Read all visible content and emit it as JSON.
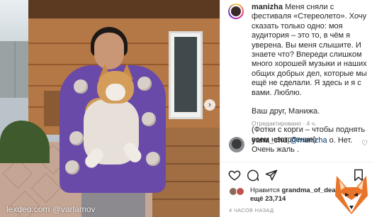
{
  "post": {
    "author": "manizha",
    "caption_paragraphs": [
      "Меня сняли с фестиваля «Стереолето». Хочу сказать только одно: моя аудитория – это то, в чём я уверена. Вы меня слышите. И знаете что? Впереди слишком много хорошей музыки и наших общих добрых дел, которые мы ещё не сделали. Я здесь и я с вами. Люблю.",
      "Ваш друг, Манижа.",
      "(Фотки с корги – чтобы поднять всем настроение)"
    ],
    "edited_label": "Отредактировано",
    "edited_age": "4 ч.",
    "carousel_arrow": "›"
  },
  "comment": {
    "author": "yana_chu",
    "mention": "@manizha",
    "text_after_mention": " о. Нет.",
    "text_line2": "Очень жаль .",
    "like_icon": "♡"
  },
  "actions": {
    "icons": [
      "heart-icon",
      "comment-icon",
      "share-icon",
      "bookmark-icon"
    ]
  },
  "likes": {
    "prefix": "Нравится ",
    "liker": "grandma_of_dead",
    "suffix": "ещё 23,714"
  },
  "timestamp": "4 ЧАСОВ НАЗАД",
  "watermark": "lexdeo.com @varlamov",
  "colors": {
    "text": "#262626",
    "muted": "#8e8e8e",
    "mention": "#00376b",
    "border": "#efefef",
    "cardigan": "#6a4aa8",
    "corgi": "#d49d5a"
  }
}
